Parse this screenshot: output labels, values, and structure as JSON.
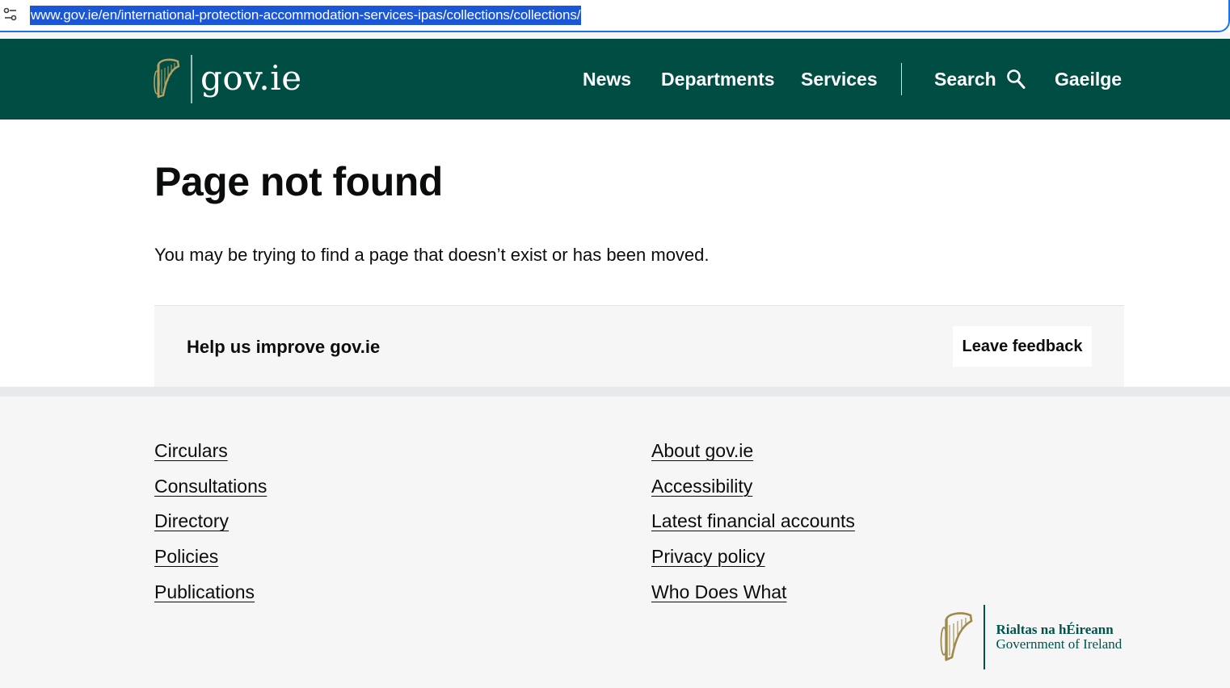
{
  "browser": {
    "url": "www.gov.ie/en/international-protection-accommodation-services-ipas/collections/collections/"
  },
  "header": {
    "logo_text": "gov.ie",
    "nav": {
      "news": "News",
      "departments": "Departments",
      "services": "Services",
      "search": "Search",
      "gaeilge": "Gaeilge"
    }
  },
  "main": {
    "title": "Page not found",
    "message": "You may be trying to find a page that doesn’t exist or has been moved.",
    "feedback": {
      "prompt": "Help us improve gov.ie",
      "button": "Leave feedback"
    }
  },
  "footer": {
    "left_links": [
      "Circulars",
      "Consultations",
      "Directory",
      "Policies",
      "Publications"
    ],
    "right_links": [
      "About gov.ie",
      "Accessibility",
      "Latest financial accounts",
      "Privacy policy",
      "Who Does What"
    ],
    "gov_logo": {
      "irish": "Rialtas na hÉireann",
      "english": "Government of Ireland"
    }
  },
  "colors": {
    "header_bg": "#004d44",
    "url_highlight": "#1a56d6",
    "footer_bg": "#f6f6f6",
    "gov_green": "#00534c"
  }
}
